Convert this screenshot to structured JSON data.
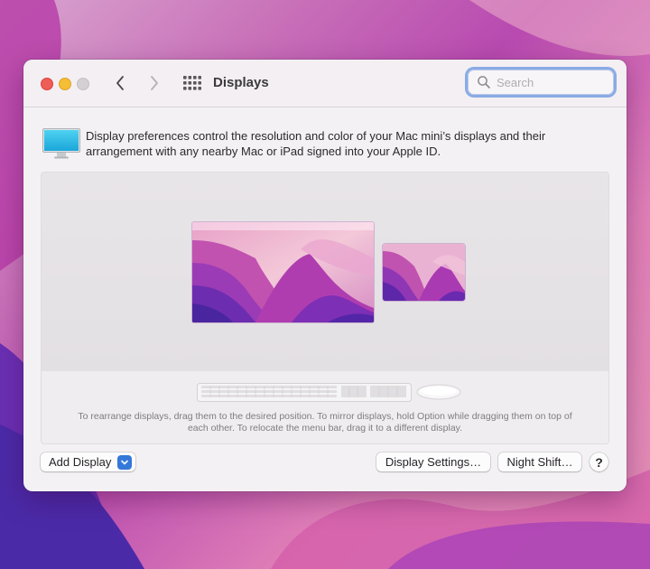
{
  "window": {
    "title": "Displays",
    "search_placeholder": "Search"
  },
  "toolbar": {
    "back_icon": "chevron-left-icon",
    "forward_icon": "chevron-right-icon",
    "grid_icon": "grid-icon",
    "search_icon": "search-icon"
  },
  "main": {
    "description": "Display preferences control the resolution and color of your Mac mini’s displays and their arrangement with any nearby Mac or iPad signed into your Apple ID.",
    "arrangement_hint": "To rearrange displays, drag them to the desired position. To mirror displays, hold Option while dragging them on top of each other. To relocate the menu bar, drag it to a different display.",
    "displays": [
      "main-display",
      "secondary-display"
    ]
  },
  "buttons": {
    "add_display": "Add Display",
    "display_settings": "Display Settings…",
    "night_shift": "Night Shift…",
    "help": "?"
  },
  "colors": {
    "close": "#ee5d56",
    "minimize": "#f5be36",
    "accent": "#3478d8",
    "search_focus": "#8aabe4"
  }
}
